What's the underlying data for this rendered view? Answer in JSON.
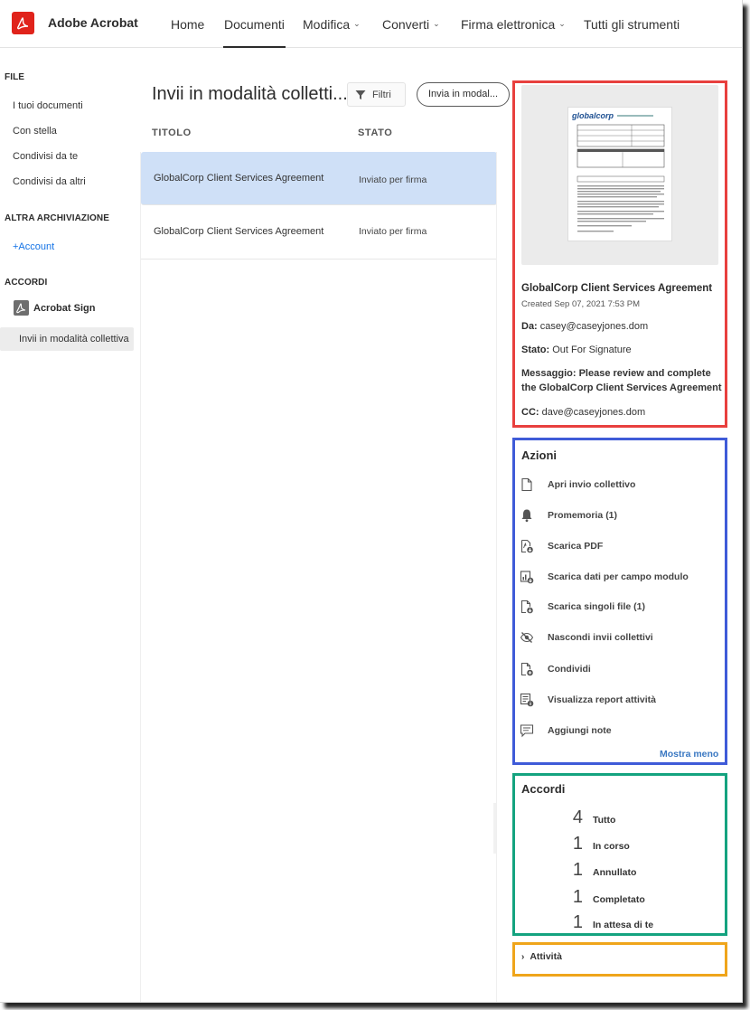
{
  "header": {
    "app_name": "Adobe Acrobat",
    "nav": [
      {
        "label": "Home"
      },
      {
        "label": "Documenti"
      },
      {
        "label": "Modifica",
        "chevron": "⌄"
      },
      {
        "label": "Converti",
        "chevron": "⌄"
      },
      {
        "label": "Firma elettronica",
        "chevron": "⌄"
      },
      {
        "label": "Tutti gli strumenti"
      }
    ],
    "active_nav": "Documenti",
    "brand_color": "#e0231b"
  },
  "sidebar": {
    "file_heading": "FILE",
    "file_items": [
      "I tuoi documenti",
      "Con stella",
      "Condivisi da te",
      "Condivisi da altri"
    ],
    "storage_heading": "ALTRA ARCHIVIAZIONE",
    "add_account": "+Account",
    "agreements_heading": "ACCORDI",
    "acrobat_sign": "Acrobat Sign",
    "selected_item": "Invii in modalità collettiva"
  },
  "main": {
    "title": "Invii in modalità colletti...",
    "filter_label": "Filtri",
    "send_button": "Invia in modal...",
    "columns": {
      "title": "TITOLO",
      "status": "STATO"
    },
    "rows": [
      {
        "title": "GlobalCorp Client Services Agreement",
        "status": "Inviato per firma",
        "selected": true
      },
      {
        "title": "GlobalCorp Client Services Agreement",
        "status": "Inviato per firma",
        "selected": false
      }
    ]
  },
  "details": {
    "doc_title": "GlobalCorp Client Services Agreement",
    "created": "Created Sep 07, 2021 7:53 PM",
    "from_label": "Da:",
    "from_value": "casey@caseyjones.dom",
    "status_label": "Stato:",
    "status_value": "Out For Signature",
    "message_label": "Messaggio:",
    "message_value": "Please review and complete the GlobalCorp Client Services Agreement",
    "cc_label": "CC:",
    "cc_value": "dave@caseyjones.dom",
    "thumbnail_logo_text": "globalcorp"
  },
  "actions": {
    "title": "Azioni",
    "items": [
      {
        "label": "Apri invio collettivo",
        "icon": "document-icon"
      },
      {
        "label": "Promemoria (1)",
        "icon": "bell-icon"
      },
      {
        "label": "Scarica PDF",
        "icon": "download-pdf-icon"
      },
      {
        "label": "Scarica dati per campo modulo",
        "icon": "download-form-data-icon"
      },
      {
        "label": "Scarica singoli file (1)",
        "icon": "download-files-icon"
      },
      {
        "label": "Nascondi invii collettivi",
        "icon": "eye-slash-icon"
      },
      {
        "label": "Condividi",
        "icon": "share-document-icon"
      },
      {
        "label": "Visualizza report attività",
        "icon": "activity-report-icon"
      },
      {
        "label": "Aggiungi note",
        "icon": "comment-icon"
      }
    ],
    "show_less": "Mostra meno"
  },
  "agreements": {
    "title": "Accordi",
    "stats": [
      {
        "count": "4",
        "label": "Tutto"
      },
      {
        "count": "1",
        "label": "In corso"
      },
      {
        "count": "1",
        "label": "Annullato"
      },
      {
        "count": "1",
        "label": "Completato"
      },
      {
        "count": "1",
        "label": "In attesa di te"
      }
    ]
  },
  "activity": {
    "label": "Attività",
    "chevron": "›"
  },
  "highlight_colors": {
    "details": "#e8403e",
    "actions": "#3f5bd8",
    "agreements": "#14a37f",
    "activity": "#efa51b"
  }
}
